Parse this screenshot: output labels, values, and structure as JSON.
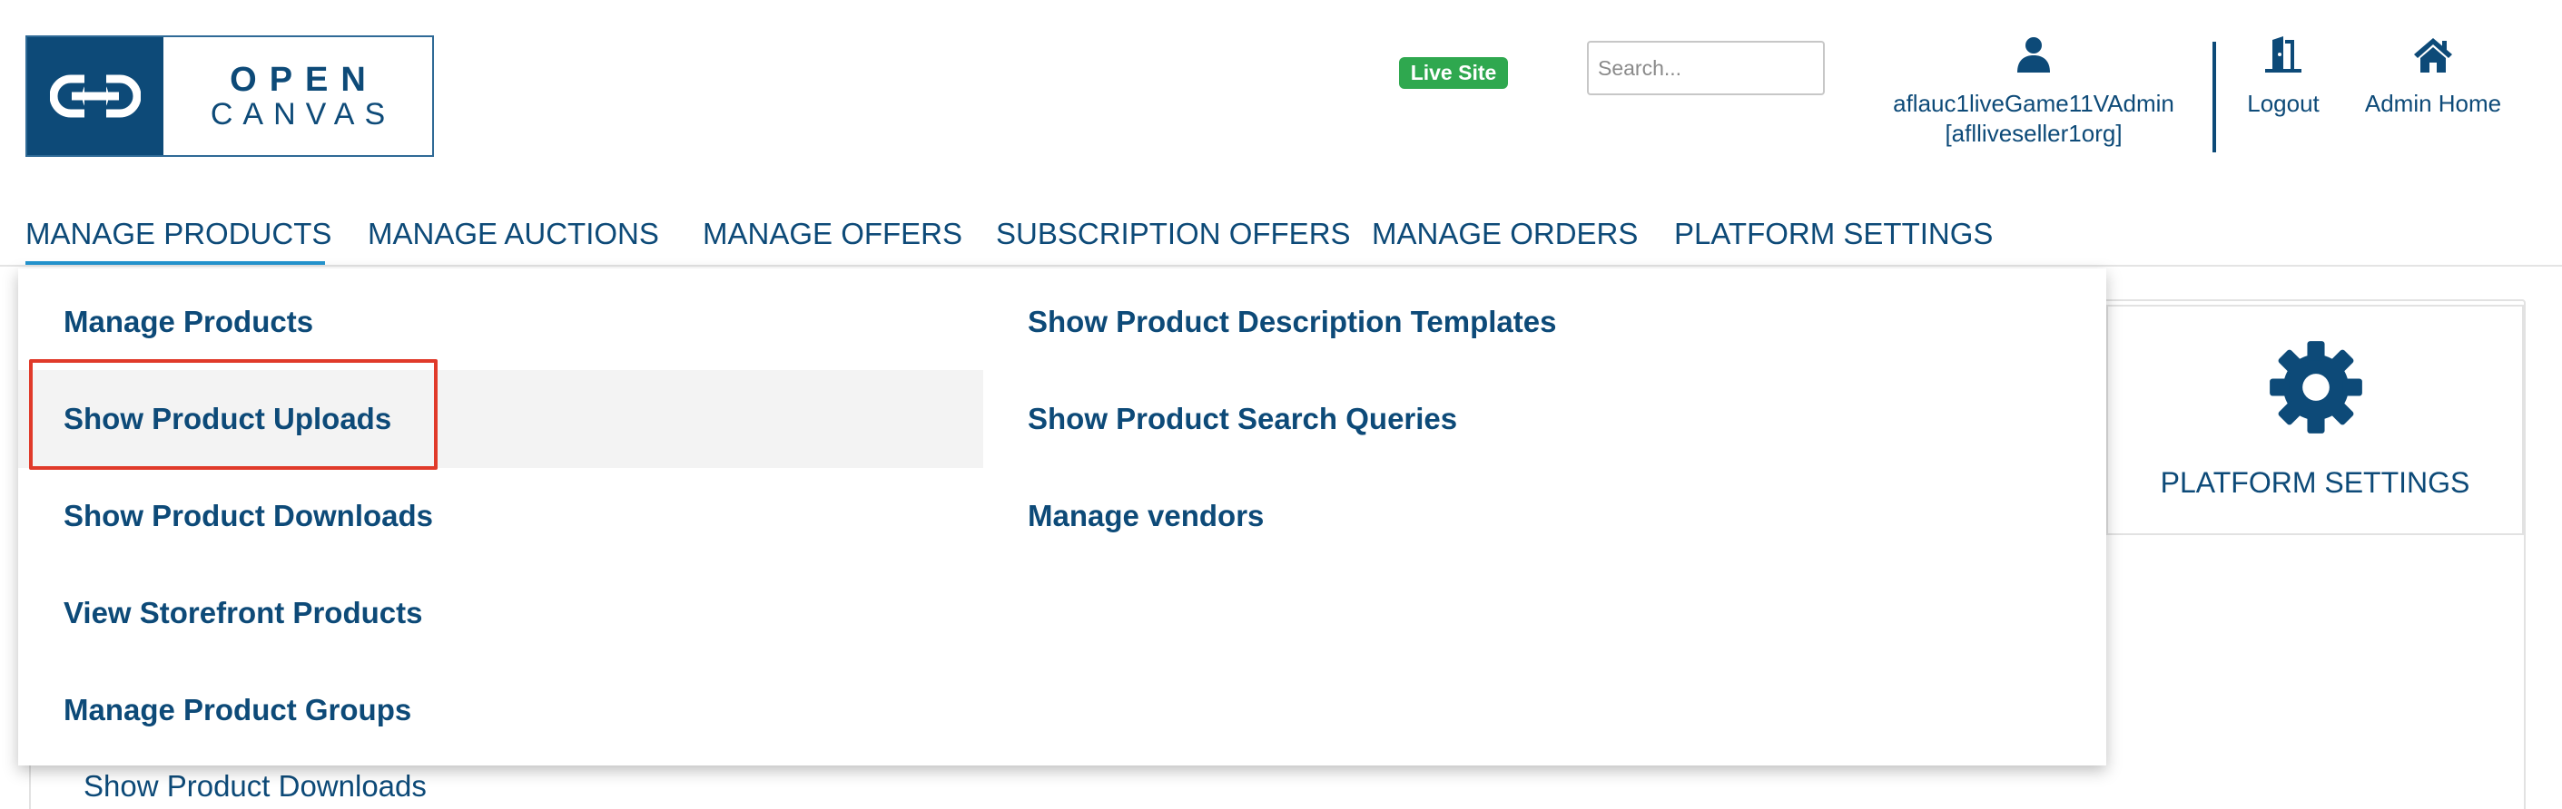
{
  "logo": {
    "open": "OPEN",
    "canvas": "CANVAS"
  },
  "header": {
    "live_site": "Live Site",
    "search_placeholder": "Search...",
    "user_name": "aflauc1liveGame11VAdmin",
    "user_org": "[aflliveseller1org]",
    "logout": "Logout",
    "admin_home": "Admin Home",
    "icons": {
      "user": "user-icon",
      "logout": "door-exit-icon",
      "home": "home-icon"
    }
  },
  "nav": {
    "tabs": [
      {
        "label": "MANAGE PRODUCTS",
        "active": true
      },
      {
        "label": "MANAGE AUCTIONS"
      },
      {
        "label": "MANAGE OFFERS"
      },
      {
        "label": "SUBSCRIPTION OFFERS"
      },
      {
        "label": "MANAGE ORDERS"
      },
      {
        "label": "PLATFORM SETTINGS"
      }
    ]
  },
  "dropdown": {
    "left": [
      "Manage Products",
      "Show Product Uploads",
      "Show Product Downloads",
      "View Storefront Products",
      "Manage Product Groups"
    ],
    "right": [
      "Show Product Description Templates",
      "Show Product Search Queries",
      "Manage vendors"
    ],
    "hovered": "Show Product Uploads"
  },
  "background": {
    "settings_card_label": "PLATFORM SETTINGS",
    "partial_link": "Show Product Downloads"
  },
  "colors": {
    "brand": "#0d4a78",
    "active_tab_underline": "#2495d0",
    "live_badge": "#2fa84f",
    "highlight": "#e03a2a"
  }
}
